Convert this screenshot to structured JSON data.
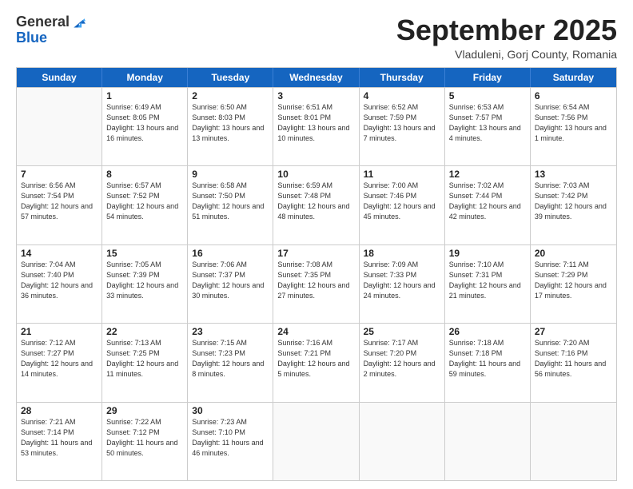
{
  "header": {
    "logo_general": "General",
    "logo_blue": "Blue",
    "month_title": "September 2025",
    "location": "Vladuleni, Gorj County, Romania"
  },
  "weekdays": [
    "Sunday",
    "Monday",
    "Tuesday",
    "Wednesday",
    "Thursday",
    "Friday",
    "Saturday"
  ],
  "weeks": [
    [
      {
        "day": "",
        "empty": true
      },
      {
        "day": "1",
        "sunrise": "Sunrise: 6:49 AM",
        "sunset": "Sunset: 8:05 PM",
        "daylight": "Daylight: 13 hours and 16 minutes."
      },
      {
        "day": "2",
        "sunrise": "Sunrise: 6:50 AM",
        "sunset": "Sunset: 8:03 PM",
        "daylight": "Daylight: 13 hours and 13 minutes."
      },
      {
        "day": "3",
        "sunrise": "Sunrise: 6:51 AM",
        "sunset": "Sunset: 8:01 PM",
        "daylight": "Daylight: 13 hours and 10 minutes."
      },
      {
        "day": "4",
        "sunrise": "Sunrise: 6:52 AM",
        "sunset": "Sunset: 7:59 PM",
        "daylight": "Daylight: 13 hours and 7 minutes."
      },
      {
        "day": "5",
        "sunrise": "Sunrise: 6:53 AM",
        "sunset": "Sunset: 7:57 PM",
        "daylight": "Daylight: 13 hours and 4 minutes."
      },
      {
        "day": "6",
        "sunrise": "Sunrise: 6:54 AM",
        "sunset": "Sunset: 7:56 PM",
        "daylight": "Daylight: 13 hours and 1 minute."
      }
    ],
    [
      {
        "day": "7",
        "sunrise": "Sunrise: 6:56 AM",
        "sunset": "Sunset: 7:54 PM",
        "daylight": "Daylight: 12 hours and 57 minutes."
      },
      {
        "day": "8",
        "sunrise": "Sunrise: 6:57 AM",
        "sunset": "Sunset: 7:52 PM",
        "daylight": "Daylight: 12 hours and 54 minutes."
      },
      {
        "day": "9",
        "sunrise": "Sunrise: 6:58 AM",
        "sunset": "Sunset: 7:50 PM",
        "daylight": "Daylight: 12 hours and 51 minutes."
      },
      {
        "day": "10",
        "sunrise": "Sunrise: 6:59 AM",
        "sunset": "Sunset: 7:48 PM",
        "daylight": "Daylight: 12 hours and 48 minutes."
      },
      {
        "day": "11",
        "sunrise": "Sunrise: 7:00 AM",
        "sunset": "Sunset: 7:46 PM",
        "daylight": "Daylight: 12 hours and 45 minutes."
      },
      {
        "day": "12",
        "sunrise": "Sunrise: 7:02 AM",
        "sunset": "Sunset: 7:44 PM",
        "daylight": "Daylight: 12 hours and 42 minutes."
      },
      {
        "day": "13",
        "sunrise": "Sunrise: 7:03 AM",
        "sunset": "Sunset: 7:42 PM",
        "daylight": "Daylight: 12 hours and 39 minutes."
      }
    ],
    [
      {
        "day": "14",
        "sunrise": "Sunrise: 7:04 AM",
        "sunset": "Sunset: 7:40 PM",
        "daylight": "Daylight: 12 hours and 36 minutes."
      },
      {
        "day": "15",
        "sunrise": "Sunrise: 7:05 AM",
        "sunset": "Sunset: 7:39 PM",
        "daylight": "Daylight: 12 hours and 33 minutes."
      },
      {
        "day": "16",
        "sunrise": "Sunrise: 7:06 AM",
        "sunset": "Sunset: 7:37 PM",
        "daylight": "Daylight: 12 hours and 30 minutes."
      },
      {
        "day": "17",
        "sunrise": "Sunrise: 7:08 AM",
        "sunset": "Sunset: 7:35 PM",
        "daylight": "Daylight: 12 hours and 27 minutes."
      },
      {
        "day": "18",
        "sunrise": "Sunrise: 7:09 AM",
        "sunset": "Sunset: 7:33 PM",
        "daylight": "Daylight: 12 hours and 24 minutes."
      },
      {
        "day": "19",
        "sunrise": "Sunrise: 7:10 AM",
        "sunset": "Sunset: 7:31 PM",
        "daylight": "Daylight: 12 hours and 21 minutes."
      },
      {
        "day": "20",
        "sunrise": "Sunrise: 7:11 AM",
        "sunset": "Sunset: 7:29 PM",
        "daylight": "Daylight: 12 hours and 17 minutes."
      }
    ],
    [
      {
        "day": "21",
        "sunrise": "Sunrise: 7:12 AM",
        "sunset": "Sunset: 7:27 PM",
        "daylight": "Daylight: 12 hours and 14 minutes."
      },
      {
        "day": "22",
        "sunrise": "Sunrise: 7:13 AM",
        "sunset": "Sunset: 7:25 PM",
        "daylight": "Daylight: 12 hours and 11 minutes."
      },
      {
        "day": "23",
        "sunrise": "Sunrise: 7:15 AM",
        "sunset": "Sunset: 7:23 PM",
        "daylight": "Daylight: 12 hours and 8 minutes."
      },
      {
        "day": "24",
        "sunrise": "Sunrise: 7:16 AM",
        "sunset": "Sunset: 7:21 PM",
        "daylight": "Daylight: 12 hours and 5 minutes."
      },
      {
        "day": "25",
        "sunrise": "Sunrise: 7:17 AM",
        "sunset": "Sunset: 7:20 PM",
        "daylight": "Daylight: 12 hours and 2 minutes."
      },
      {
        "day": "26",
        "sunrise": "Sunrise: 7:18 AM",
        "sunset": "Sunset: 7:18 PM",
        "daylight": "Daylight: 11 hours and 59 minutes."
      },
      {
        "day": "27",
        "sunrise": "Sunrise: 7:20 AM",
        "sunset": "Sunset: 7:16 PM",
        "daylight": "Daylight: 11 hours and 56 minutes."
      }
    ],
    [
      {
        "day": "28",
        "sunrise": "Sunrise: 7:21 AM",
        "sunset": "Sunset: 7:14 PM",
        "daylight": "Daylight: 11 hours and 53 minutes."
      },
      {
        "day": "29",
        "sunrise": "Sunrise: 7:22 AM",
        "sunset": "Sunset: 7:12 PM",
        "daylight": "Daylight: 11 hours and 50 minutes."
      },
      {
        "day": "30",
        "sunrise": "Sunrise: 7:23 AM",
        "sunset": "Sunset: 7:10 PM",
        "daylight": "Daylight: 11 hours and 46 minutes."
      },
      {
        "day": "",
        "empty": true
      },
      {
        "day": "",
        "empty": true
      },
      {
        "day": "",
        "empty": true
      },
      {
        "day": "",
        "empty": true
      }
    ]
  ]
}
